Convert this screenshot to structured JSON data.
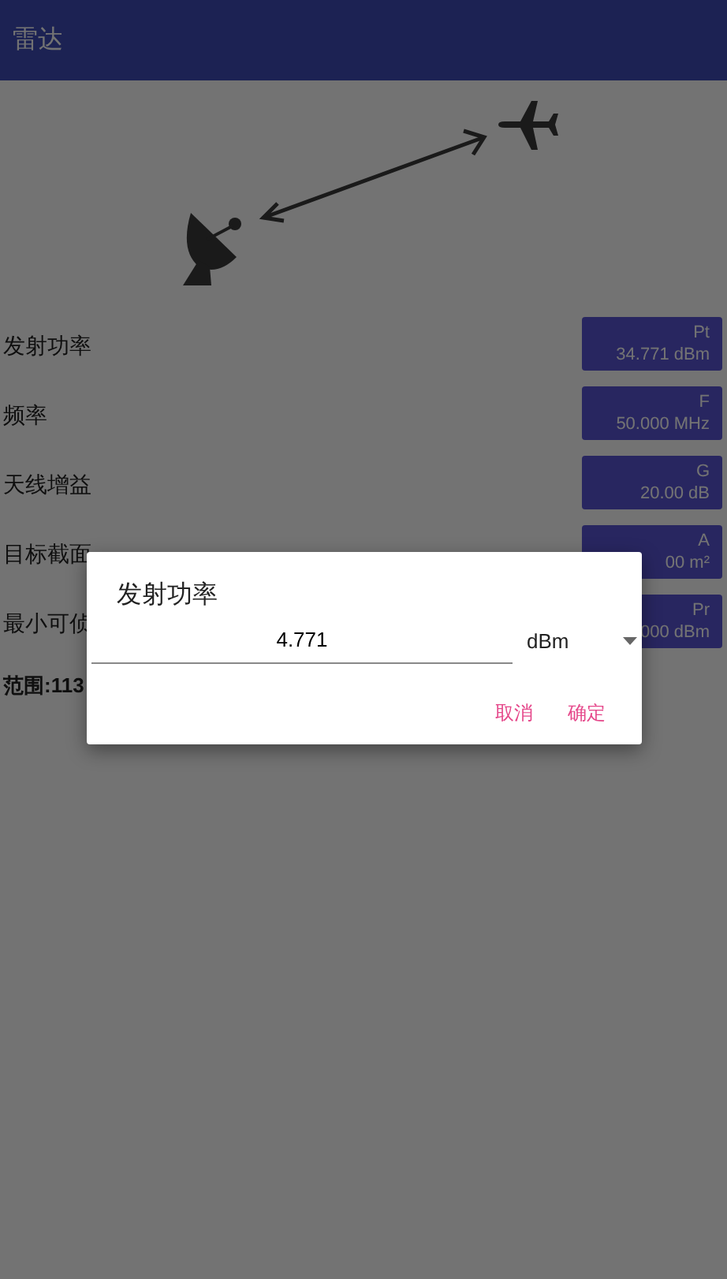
{
  "app_bar": {
    "title": "雷达"
  },
  "parameters": [
    {
      "label": "发射功率",
      "symbol": "Pt",
      "value": "34.771 dBm"
    },
    {
      "label": "频率",
      "symbol": "F",
      "value": "50.000 MHz"
    },
    {
      "label": "天线增益",
      "symbol": "G",
      "value": "20.00 dB"
    },
    {
      "label": "目标截面",
      "symbol": "A",
      "value": "00 m²"
    },
    {
      "label": "最小可侦",
      "symbol": "Pr",
      "value": "000 dBm"
    }
  ],
  "result": "范围:113",
  "dialog": {
    "title": "发射功率",
    "input_value": "4.771",
    "unit": "dBm",
    "buttons": [
      "取消",
      "确定"
    ]
  }
}
